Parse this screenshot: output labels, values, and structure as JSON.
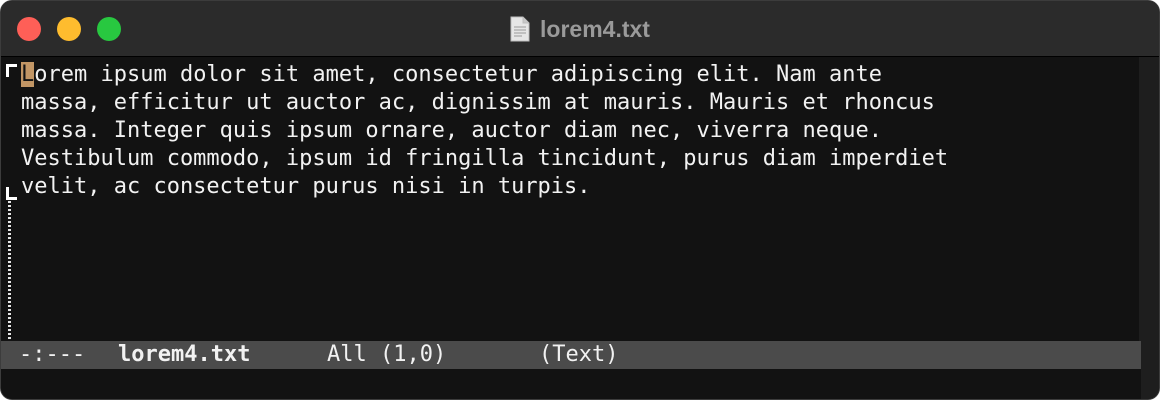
{
  "window": {
    "title": "lorem4.txt",
    "buttons": {
      "close": "close",
      "minimize": "minimize",
      "zoom": "zoom"
    },
    "title_icon": "document-icon"
  },
  "editor": {
    "cursor_char": "L",
    "first_line_rest": "orem ipsum dolor sit amet, consectetur adipiscing elit. Nam ante",
    "lines": [
      "massa, efficitur ut auctor ac, dignissim at mauris. Mauris et rhoncus",
      "massa. Integer quis ipsum ornare, auctor diam nec, viverra neque.",
      "Vestibulum commodo, ipsum id fringilla tincidunt, purus diam imperdiet",
      "velit, ac consectetur purus nisi in turpis."
    ]
  },
  "modeline": {
    "status": "-:---",
    "buffer_name": "lorem4.txt",
    "position": "All (1,0)",
    "mode": "(Text)"
  },
  "colors": {
    "background": "#121212",
    "cursor": "#c29665",
    "modeline_bg": "#4b4b4b"
  }
}
